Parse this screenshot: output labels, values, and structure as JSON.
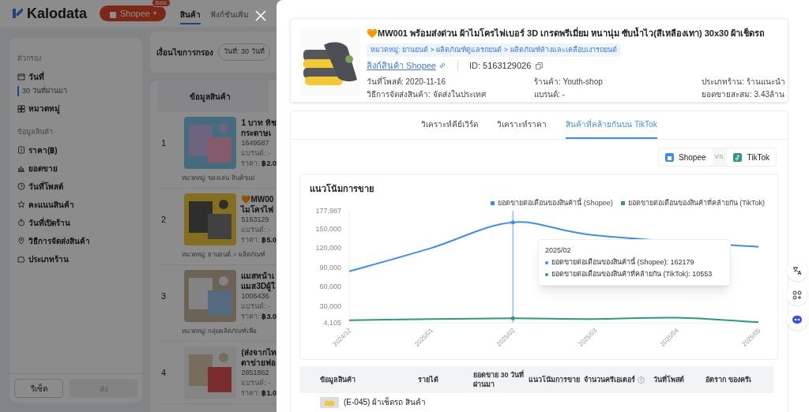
{
  "header": {
    "logo": "Kalodata",
    "platform": "Shopee",
    "platform_caret": "▾",
    "platform_badge": "Beta",
    "nav": [
      {
        "label": "สินค้า",
        "selected": true
      },
      {
        "label": "ฟังก์ชันเพิ่ม",
        "selected": false
      }
    ]
  },
  "filters": {
    "title": "ตัวกรอง",
    "date_label": "วันที่",
    "date_value": "30 วันที่ผ่านมา",
    "category_label": "หมวดหมู่",
    "product_section": "ข้อมูลสินค้า",
    "items": [
      {
        "kind": "price",
        "label": "ราคา(฿)"
      },
      {
        "kind": "sales",
        "label": "ยอดขาย"
      },
      {
        "kind": "clock",
        "label": "วันที่โพสต์"
      },
      {
        "kind": "star",
        "label": "คะแนนสินค้า"
      },
      {
        "kind": "timer",
        "label": "วันที่เปิดร้าน"
      },
      {
        "kind": "pin",
        "label": "วิธีการจัดส่งสินค้า"
      },
      {
        "kind": "puzzle",
        "label": "ประเภทร้าน"
      }
    ],
    "buttons": [
      {
        "label": "รีเซ็ต",
        "disabled": false
      },
      {
        "label": "ส่ง",
        "disabled": true
      }
    ]
  },
  "filter_conditions": {
    "label": "เงื่อนไขการกรอง",
    "chip": "วันที่: 30 วันที่"
  },
  "list": {
    "column": "ข้อมูลสินค้า",
    "rows": [
      {
        "rank": "1",
        "title": [
          "1 บาท ทิช",
          "กระดาษเ"
        ],
        "id": "1649587",
        "brand": "แบรนด์: -",
        "price_label": "ราคา:",
        "price": "฿2.0",
        "category": "หมวดหมู่: ของเล่น สินค้าแม่"
      },
      {
        "rank": "2",
        "title": [
          "🧡MW00",
          "ไมโครไฟ"
        ],
        "id": "5163129",
        "brand": "แบรนด์: -",
        "price_label": "ราคา:",
        "price": "฿5.0",
        "category": "หมวดหมู่: ยานยนต์ > ผลิตภัณฑ์"
      },
      {
        "rank": "3",
        "title": [
          "แมสหน้าเ",
          "แมส3Dผู้ใ"
        ],
        "id": "1006436",
        "brand": "แบรนด์: -",
        "price_label": "ราคา:",
        "price": "฿3.0",
        "category": "หมวดหมู่: กลุ่มผลิตภัณฑ์เพื่อ"
      },
      {
        "rank": "4",
        "title": [
          "(ส่งจากไท",
          "ตาข่ายฟอ"
        ],
        "id": "2851862",
        "brand": "แบรนด์: -",
        "price_label": "ราคา:",
        "price": "฿1.0"
      }
    ]
  },
  "modal": {
    "product": {
      "title": "🧡MW001 พร้อมส่งด่วน ผ้าไมโครไฟเบอร์ 3D เกรดพรีเมี่ยม หนานุ่ม ซับน้ำไว(สีเหลืองเทา) 30x30 ผ้าเช็ดรถ",
      "category": "หมวดหมู่: ยานยนต์ > ผลิตภัณฑ์ดูแลรถยนต์ > ผลิตภัณฑ์ล้างและเคลือบเงารถยนต์",
      "link": "ลิงก์สินค้า Shopee",
      "id_label": "ID:",
      "id": "5163129026",
      "details": [
        "วันที่โพสต์: 2020-11-16",
        "ร้านค้า: Youth-shop",
        "ประเภทร้าน: ร้านแนะนำ",
        "วิธีการจัดส่งสินค้า: จัดส่งในประเทศ",
        "แบรนด์: -",
        "ยอดขายสะสม: 3.43ล้าน"
      ]
    },
    "tabs": [
      {
        "label": "วิเคราะห์คีย์เวิร์ด",
        "selected": false
      },
      {
        "label": "วิเคราะห์ราคา",
        "selected": false
      },
      {
        "label": "สินค้าที่คล้ายกันบน TikTok",
        "selected": true
      }
    ],
    "compare": {
      "left": "Shopee",
      "vs": "VS.",
      "right": "TikTok"
    },
    "chart_data": {
      "type": "line",
      "title": "แนวโน้มการขาย",
      "categories": [
        "2024/12",
        "2025/01",
        "2025/02",
        "2025/03",
        "2025/04",
        "2025/05"
      ],
      "series": [
        {
          "name": "ยอดขายต่อเดือนของสินค้านี้ (Shopee)",
          "color": "#3b8ef0",
          "values": [
            84000,
            120000,
            160000,
            140000,
            null,
            122000
          ]
        },
        {
          "name": "ยอดขายต่อเดือนของสินค้าที่คล้ายกัน (TikTok)",
          "color": "#2f9688",
          "values": [
            8000,
            10000,
            11000,
            10000,
            12000,
            5000
          ]
        }
      ],
      "ylim": [
        4105,
        177987
      ],
      "yticks": [
        {
          "value": 4105,
          "label": "4,105"
        },
        {
          "value": 30000,
          "label": "30,000"
        },
        {
          "value": 60000,
          "label": "60,000"
        },
        {
          "value": 90000,
          "label": "90,000"
        },
        {
          "value": 120000,
          "label": "120,000"
        },
        {
          "value": 150000,
          "label": "150,000"
        },
        {
          "value": 177987,
          "label": "177,987"
        }
      ],
      "ref_lines": [
        {
          "axis": "x",
          "value": "2025/02"
        }
      ]
    },
    "tooltip": {
      "title": "2025/02",
      "lines": [
        "ยอดขายต่อเดือนของสินค้านี้ (Shopee): 162179",
        "ยอดขายต่อเดือนของสินค้าที่คล้ายกัน (TikTok): 10553"
      ]
    },
    "table": {
      "columns": [
        {
          "label": "ข้อมูลสินค้า",
          "kind": "plain"
        },
        {
          "label": "รายได้",
          "kind": "plain"
        },
        {
          "label": "ยอดขาย 30 วันที่ผ่านมา",
          "kind": "plain"
        },
        {
          "label": "แนวโน้มการขาย",
          "kind": "plain"
        },
        {
          "label": "จำนวนครีเอเตอร์",
          "kind": "help"
        },
        {
          "label": "วันที่โพสต์",
          "kind": "plain"
        },
        {
          "label": "อัตราก ของครีเ",
          "kind": "plain"
        }
      ],
      "rows": [
        {
          "title": "(E-045) ผ้าเช็ดรถ สินค้า"
        }
      ]
    }
  }
}
